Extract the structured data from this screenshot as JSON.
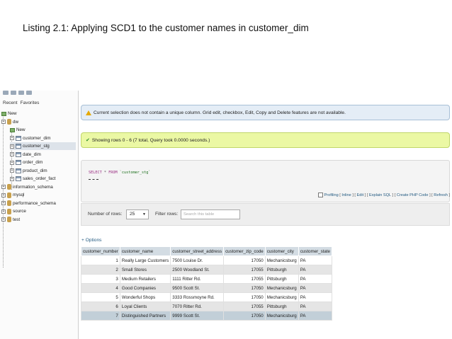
{
  "slide": {
    "caption": "Listing 2.1: Applying SCD1 to the customer names in customer_dim"
  },
  "sidebar": {
    "tabs": [
      "Recent",
      "Favorites"
    ],
    "items": [
      {
        "label": "New",
        "level": 0,
        "icon": "new-icon"
      },
      {
        "label": "dw",
        "level": 0,
        "icon": "database-icon"
      },
      {
        "label": "New",
        "level": 1,
        "icon": "new-icon"
      },
      {
        "label": "customer_dim",
        "level": 1,
        "icon": "table-icon"
      },
      {
        "label": "customer_stg",
        "level": 1,
        "icon": "table-icon",
        "active": true
      },
      {
        "label": "date_dim",
        "level": 1,
        "icon": "table-icon"
      },
      {
        "label": "order_dim",
        "level": 1,
        "icon": "table-icon"
      },
      {
        "label": "product_dim",
        "level": 1,
        "icon": "table-icon"
      },
      {
        "label": "sales_order_fact",
        "level": 1,
        "icon": "table-icon"
      },
      {
        "label": "information_schema",
        "level": 0,
        "icon": "database-icon"
      },
      {
        "label": "mysql",
        "level": 0,
        "icon": "database-icon"
      },
      {
        "label": "performance_schema",
        "level": 0,
        "icon": "database-icon"
      },
      {
        "label": "source",
        "level": 0,
        "icon": "database-icon"
      },
      {
        "label": "test",
        "level": 0,
        "icon": "database-icon"
      }
    ]
  },
  "messages": {
    "notice": "Current selection does not contain a unique column. Grid edit, checkbox, Edit, Copy and Delete features are not available.",
    "success": "Showing rows 0 - 6 (7 total, Query took 0.0000 seconds.)"
  },
  "sql": {
    "keyword1": "SELECT",
    "star": "*",
    "keyword2": "FROM",
    "table": "`customer_stg`"
  },
  "sql_links": {
    "profiling": "Profiling",
    "inline": "Inline",
    "edit": "Edit",
    "explain": "Explain SQL",
    "php": "Create PHP Code",
    "refresh": "Refresh"
  },
  "nav": {
    "rows_label": "Number of rows:",
    "rows_value": "25",
    "filter_label": "Filter rows:",
    "filter_placeholder": "Search this table"
  },
  "options_label": "+ Options",
  "table": {
    "columns": [
      "customer_number",
      "customer_name",
      "customer_street_address",
      "customer_zip_code",
      "customer_city",
      "customer_state"
    ],
    "rows": [
      [
        "1",
        "Really Large Customers",
        "7500 Louise Dr.",
        "17050",
        "Mechanicsburg",
        "PA"
      ],
      [
        "2",
        "Small Stores",
        "2500 Woodland St.",
        "17055",
        "Pittsburgh",
        "PA"
      ],
      [
        "3",
        "Medium Retailers",
        "1111 Ritter Rd.",
        "17055",
        "Pittsburgh",
        "PA"
      ],
      [
        "4",
        "Good Companies",
        "9500 Scott St.",
        "17050",
        "Mechanicsburg",
        "PA"
      ],
      [
        "5",
        "Wonderful Shops",
        "3333 Rossmoyne Rd.",
        "17050",
        "Mechanicsburg",
        "PA"
      ],
      [
        "6",
        "Loyal Clients",
        "7070 Ritter Rd.",
        "17055",
        "Pittsburgh",
        "PA"
      ],
      [
        "7",
        "Distinguished Partners",
        "9999 Scott St.",
        "17050",
        "Mechanicsburg",
        "PA"
      ]
    ],
    "highlighted_row": 6
  }
}
